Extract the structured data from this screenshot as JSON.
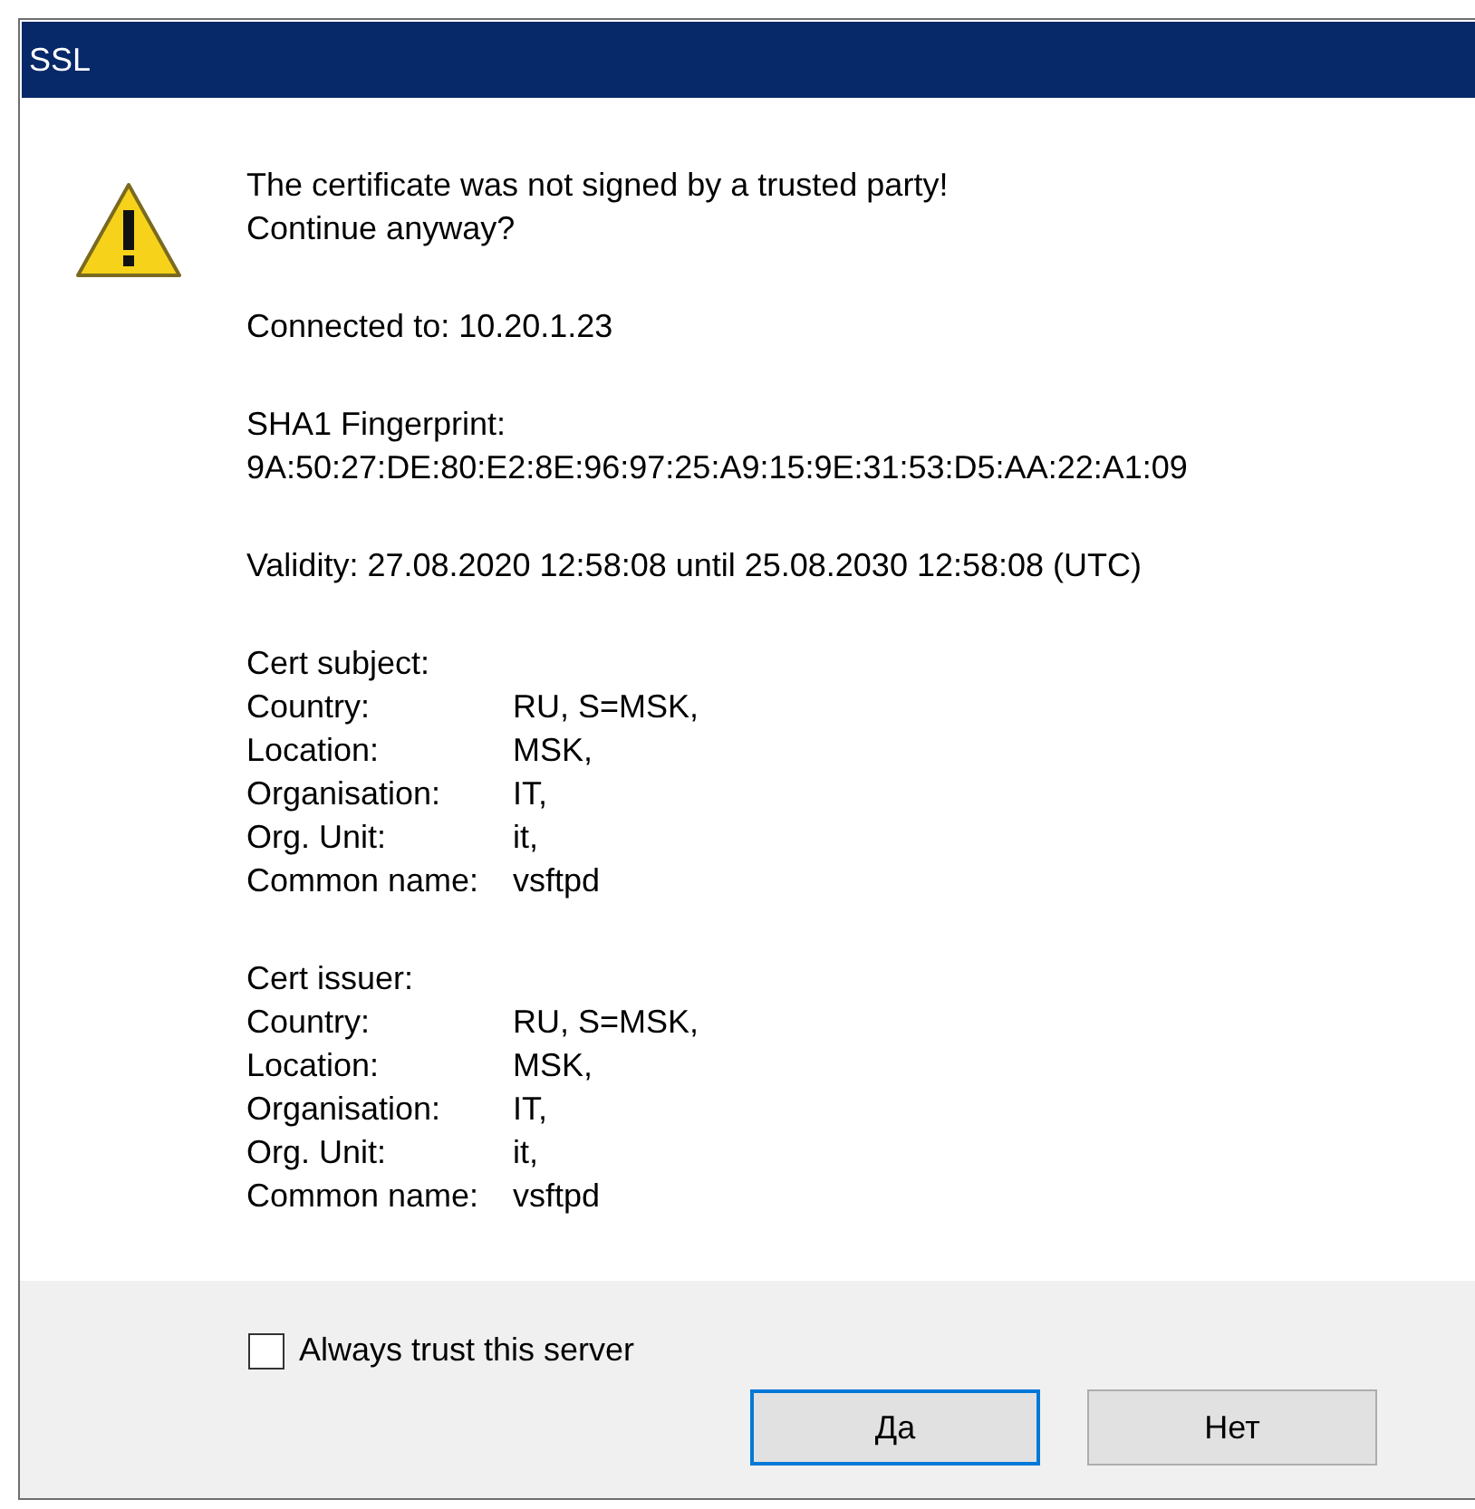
{
  "window": {
    "title": "SSL"
  },
  "message": [
    "The certificate was not signed by a trusted party!",
    "Continue anyway?"
  ],
  "connected": "Connected to: 10.20.1.23",
  "fingerprint": {
    "label": "SHA1 Fingerprint:",
    "value": "9A:50:27:DE:80:E2:8E:96:97:25:A9:15:9E:31:53:D5:AA:22:A1:09"
  },
  "validity": "Validity: 27.08.2020 12:58:08 until 25.08.2030 12:58:08 (UTC)",
  "sections": [
    {
      "heading": "Cert subject:",
      "fields": [
        {
          "label": "Country:",
          "value": "RU, S=MSK,"
        },
        {
          "label": "Location:",
          "value": "MSK,"
        },
        {
          "label": "Organisation:",
          "value": "IT,"
        },
        {
          "label": "Org. Unit:",
          "value": "it,"
        },
        {
          "label": "Common name:",
          "value": "vsftpd"
        }
      ]
    },
    {
      "heading": "Cert issuer:",
      "fields": [
        {
          "label": "Country:",
          "value": "RU, S=MSK,"
        },
        {
          "label": "Location:",
          "value": "MSK,"
        },
        {
          "label": "Organisation:",
          "value": "IT,"
        },
        {
          "label": "Org. Unit:",
          "value": "it,"
        },
        {
          "label": "Common name:",
          "value": "vsftpd"
        }
      ]
    }
  ],
  "always_trust": {
    "label": "Always trust this server",
    "checked": false
  },
  "buttons": [
    {
      "label": "Да",
      "focused": true
    },
    {
      "label": "Нет",
      "focused": false
    }
  ]
}
